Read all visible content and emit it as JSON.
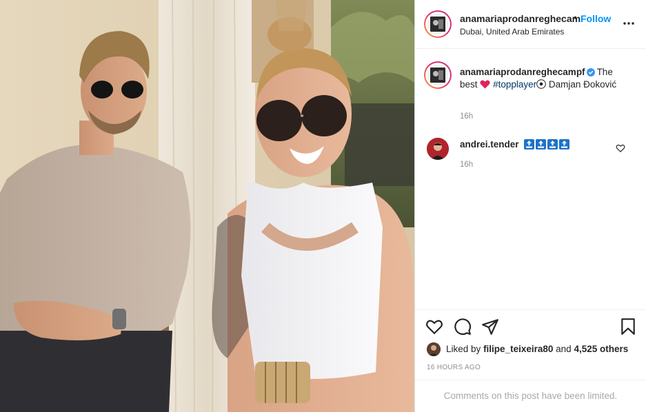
{
  "post": {
    "header": {
      "username": "anamariaprodanreghecam",
      "separator": "•",
      "follow_label": "Follow",
      "location": "Dubai, United Arab Emirates",
      "more_icon": "more-horizontal-icon"
    },
    "caption": {
      "username": "anamariaprodanreghecampf",
      "verified": true,
      "text_before": "The best",
      "heart_emoji": "❤️",
      "hashtag": "#topplayer",
      "ball_emoji": "⚽",
      "text_after": "Damjan Đoković",
      "time": "16h"
    },
    "comments": [
      {
        "username": "andrei.tender",
        "badges": [
          "🔝",
          "🔝",
          "🔝",
          "🔝"
        ],
        "time": "16h"
      }
    ],
    "actions": {
      "like_icon": "heart-outline-icon",
      "comment_icon": "comment-bubble-icon",
      "share_icon": "paper-plane-icon",
      "save_icon": "bookmark-icon"
    },
    "likes": {
      "prefix": "Liked by",
      "user": "filipe_teixeira80",
      "middle": "and",
      "count": "4,525 others"
    },
    "timestamp": "16 HOURS AGO",
    "limited_notice": "Comments on this post have been limited."
  },
  "colors": {
    "link_blue": "#0095f6",
    "hashtag_blue": "#00376b",
    "muted": "#8e8e8e",
    "text": "#262626",
    "story_ring_start": "#f9a13a",
    "story_ring_end": "#c13584"
  }
}
